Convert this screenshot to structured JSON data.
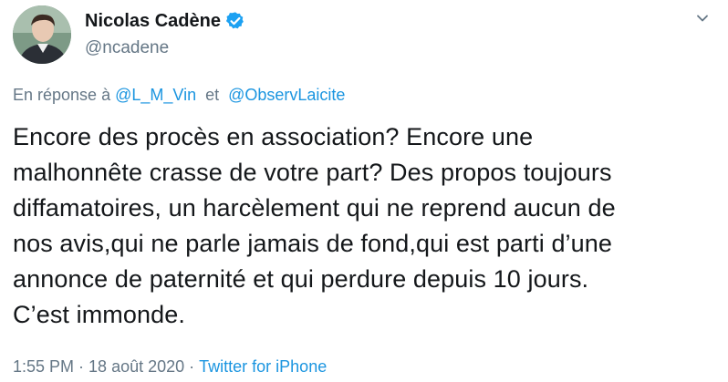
{
  "author": {
    "name": "Nicolas Cadène",
    "handle": "@ncadene",
    "verified": true
  },
  "reply": {
    "prefix": "En réponse à",
    "mentions": [
      "@L_M_Vin",
      "@ObservLaicite"
    ],
    "joiner": "et"
  },
  "tweet": {
    "text": "Encore des procès en association? Encore une\nmalhonnête crasse de votre part? Des propos toujours\ndiffamatoires, un harcèlement qui ne reprend aucun de\nnos avis,qui ne parle jamais de fond,qui est parti d’une\nannonce de paternité et qui perdure depuis 10 jours.\nC’est immonde."
  },
  "meta": {
    "time": "1:55 PM",
    "separator": "·",
    "date": "18 août 2020",
    "source": "Twitter for iPhone"
  },
  "colors": {
    "text": "#14171a",
    "secondary": "#657786",
    "link": "#1b95e0",
    "verified": "#1da1f2"
  },
  "icons": {
    "verified": "verified-badge-icon",
    "caret": "chevron-down-icon"
  }
}
